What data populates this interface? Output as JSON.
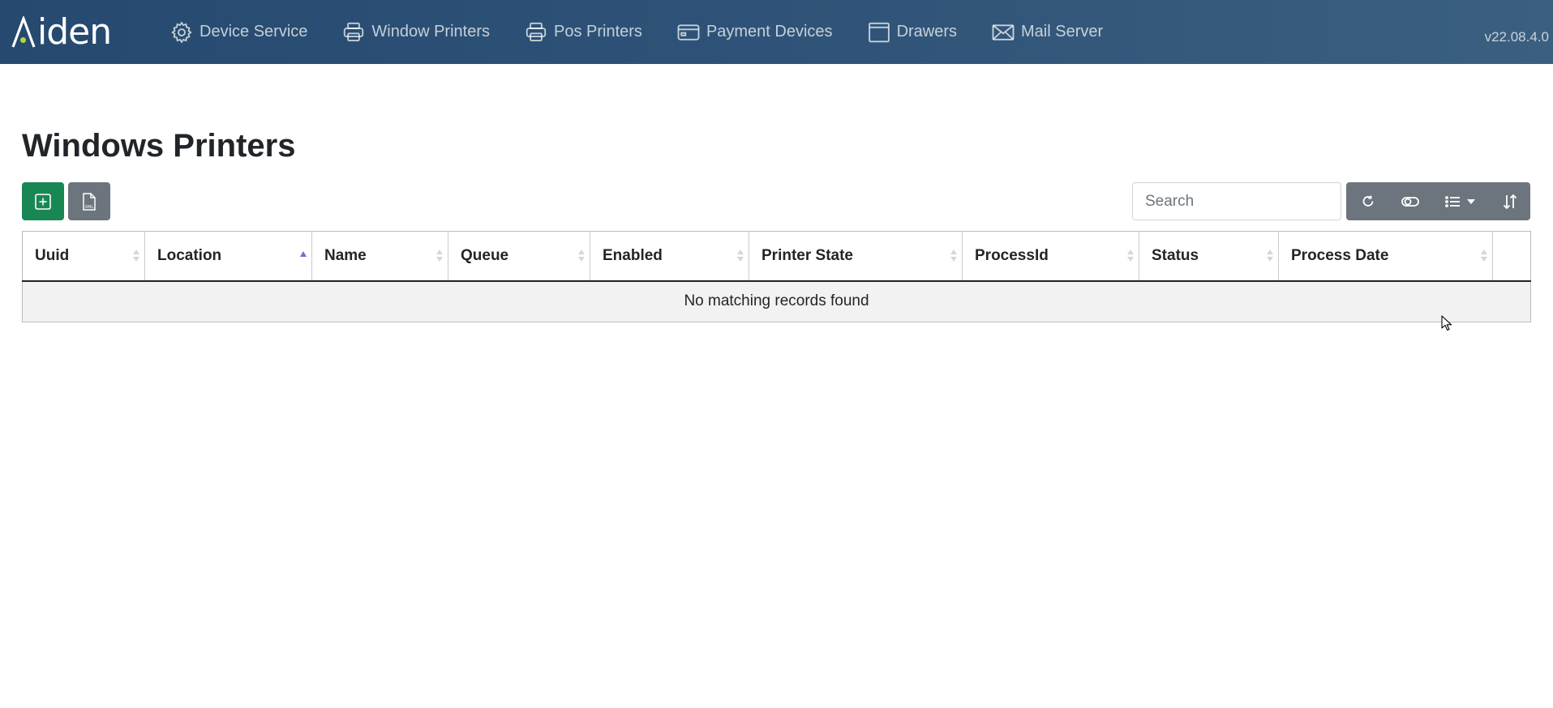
{
  "brand": {
    "name": "Aiden",
    "logo_rest": "iden",
    "accent_color": "#b8d63a"
  },
  "nav": {
    "items": [
      {
        "label": "Device Service",
        "icon": "gear-icon"
      },
      {
        "label": "Window Printers",
        "icon": "printer-icon"
      },
      {
        "label": "Pos Printers",
        "icon": "printer-icon"
      },
      {
        "label": "Payment Devices",
        "icon": "credit-card-icon"
      },
      {
        "label": "Drawers",
        "icon": "drawer-icon"
      },
      {
        "label": "Mail Server",
        "icon": "envelope-icon"
      }
    ],
    "version": "v22.08.4.0"
  },
  "page": {
    "title": "Windows Printers"
  },
  "toolbar": {
    "add_icon": "plus-square-icon",
    "export_icon": "xml-file-icon",
    "export_badge": "XML",
    "search_placeholder": "Search",
    "search_value": "",
    "group_icons": [
      "refresh-icon",
      "toggle-icon",
      "columns-list-icon",
      "sort-icon"
    ]
  },
  "table": {
    "columns": [
      {
        "label": "Uuid",
        "sort": "none"
      },
      {
        "label": "Location",
        "sort": "asc"
      },
      {
        "label": "Name",
        "sort": "none"
      },
      {
        "label": "Queue",
        "sort": "none"
      },
      {
        "label": "Enabled",
        "sort": "none"
      },
      {
        "label": "Printer State",
        "sort": "none"
      },
      {
        "label": "ProcessId",
        "sort": "none"
      },
      {
        "label": "Status",
        "sort": "none"
      },
      {
        "label": "Process Date",
        "sort": "none"
      },
      {
        "label": "",
        "sort": "none"
      }
    ],
    "rows": [],
    "empty_message": "No matching records found"
  },
  "colors": {
    "navbar": "#2f5378",
    "success": "#198754",
    "secondary": "#6c757d",
    "sort_active": "#6f6fd8"
  }
}
